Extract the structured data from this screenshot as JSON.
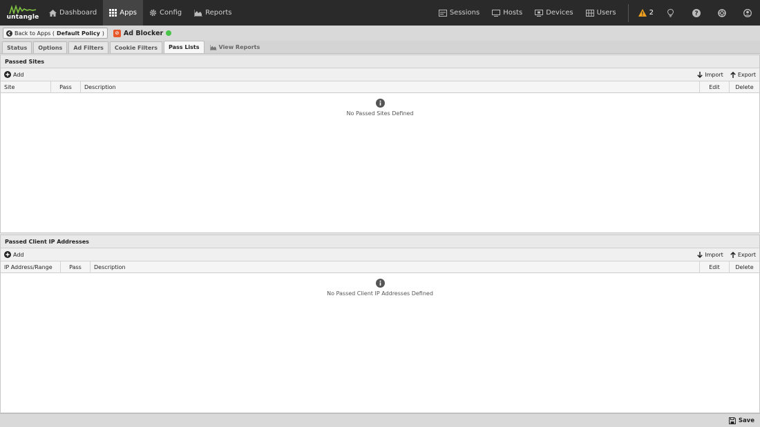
{
  "logo": {
    "text": "untangle"
  },
  "nav": {
    "left": [
      {
        "label": "Dashboard",
        "icon": "home-icon"
      },
      {
        "label": "Apps",
        "icon": "grid-icon"
      },
      {
        "label": "Config",
        "icon": "gear-icon"
      },
      {
        "label": "Reports",
        "icon": "area-chart-icon"
      }
    ],
    "right": [
      {
        "label": "Sessions",
        "icon": "sessions-icon"
      },
      {
        "label": "Hosts",
        "icon": "hosts-icon"
      },
      {
        "label": "Devices",
        "icon": "devices-icon"
      },
      {
        "label": "Users",
        "icon": "users-icon"
      }
    ],
    "alerts_count": "2"
  },
  "app_header": {
    "back_prefix": "Back to Apps (",
    "back_policy": "Default Policy",
    "back_suffix": ")",
    "app_name": "Ad Blocker",
    "status_color": "#47c347"
  },
  "tabs": [
    "Status",
    "Options",
    "Ad Filters",
    "Cookie Filters",
    "Pass Lists"
  ],
  "view_reports_label": "View Reports",
  "passed_sites": {
    "title": "Passed Sites",
    "add_label": "Add",
    "import_label": "Import",
    "export_label": "Export",
    "columns": [
      "Site",
      "Pass",
      "Description",
      "Edit",
      "Delete"
    ],
    "empty_text": "No Passed Sites Defined"
  },
  "passed_clients": {
    "title": "Passed Client IP Addresses",
    "add_label": "Add",
    "import_label": "Import",
    "export_label": "Export",
    "columns": [
      "IP Address/Range",
      "Pass",
      "Description",
      "Edit",
      "Delete"
    ],
    "empty_text": "No Passed Client IP Addresses Defined"
  },
  "footer": {
    "save_label": "Save"
  }
}
